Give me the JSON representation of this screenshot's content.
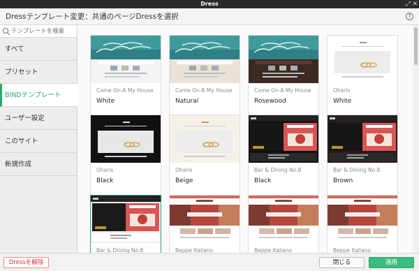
{
  "window": {
    "title": "Dress"
  },
  "header": {
    "title": "Dressテンプレート変更：共通のページDressを選択",
    "help": "?"
  },
  "search": {
    "placeholder": "テンプレートを検索"
  },
  "sidebar": {
    "items": [
      {
        "label": "すべて"
      },
      {
        "label": "プリセット"
      },
      {
        "label": "BINDテンプレート",
        "active": true
      },
      {
        "label": "ユーザー設定"
      },
      {
        "label": "このサイト"
      },
      {
        "label": "新規作成"
      }
    ]
  },
  "templates": [
    {
      "name": "Come On-A My House",
      "variant": "White",
      "style": "house",
      "tone": "white"
    },
    {
      "name": "Come On-A My House",
      "variant": "Natural",
      "style": "house",
      "tone": "natural"
    },
    {
      "name": "Come On-A My House",
      "variant": "Rosewood",
      "style": "house",
      "tone": "rosewood"
    },
    {
      "name": "Oharis",
      "variant": "White",
      "style": "oharis",
      "tone": "white"
    },
    {
      "name": "Oharis",
      "variant": "Black",
      "style": "oharis",
      "tone": "black"
    },
    {
      "name": "Oharis",
      "variant": "Beige",
      "style": "oharis",
      "tone": "beige"
    },
    {
      "name": "Bar & Dining No.8",
      "variant": "Black",
      "style": "bar",
      "tone": "black"
    },
    {
      "name": "Bar & Dining No.8",
      "variant": "Brown",
      "style": "bar",
      "tone": "brown"
    },
    {
      "name": "Bar & Dining No.8",
      "variant": "",
      "style": "bar",
      "tone": "white",
      "selected": true
    },
    {
      "name": "Beppe Italiano",
      "variant": "",
      "style": "beppe",
      "tone": "a"
    },
    {
      "name": "Beppe Italiano",
      "variant": "",
      "style": "beppe",
      "tone": "b"
    },
    {
      "name": "Beppe Italiano",
      "variant": "",
      "style": "beppe",
      "tone": "c"
    }
  ],
  "footer": {
    "remove": "Dressを解除",
    "close": "閉じる",
    "apply": "適用"
  },
  "colors": {
    "accent": "#2ba86d",
    "apply_bg": "#3cbc7e",
    "remove_text": "#dd3333"
  }
}
